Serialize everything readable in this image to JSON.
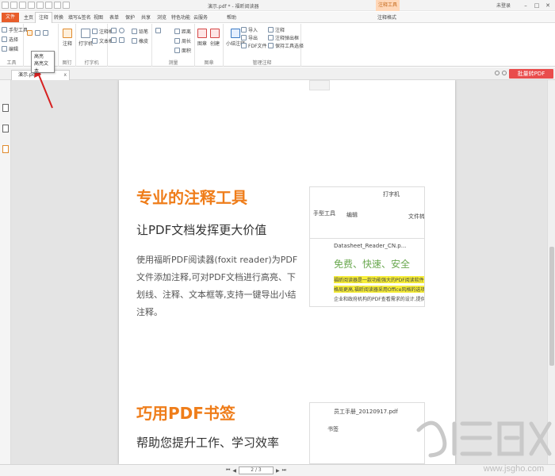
{
  "titlebar": {
    "title": "演示.pdf * - 福昕阅读器",
    "context_tab": "注释工具",
    "login": "未登录"
  },
  "menubar": {
    "file": "文件",
    "tabs": [
      "主页",
      "注释",
      "转换",
      "填写&签名",
      "视图",
      "表单",
      "保护",
      "共享",
      "浏览",
      "特色功能",
      "云服务",
      "帮助",
      "注释格式"
    ],
    "active_tab": "注释",
    "search_placeholder": "查找"
  },
  "ribbon": {
    "tools_group": {
      "items": [
        "手型工具",
        "选择",
        "编辑"
      ],
      "label": "工具"
    },
    "text_markup": {
      "label": "文本标记"
    },
    "pin_group": {
      "items": [
        "注释",
        "文件"
      ],
      "label": "图钉"
    },
    "typewriter": {
      "items": [
        "打字机",
        "注释框",
        "文本框"
      ],
      "label": "打字机"
    },
    "drawing": {
      "items": [
        "铅笔",
        "橡皮"
      ],
      "label": "绘图"
    },
    "measure": {
      "items": [
        "距离",
        "周长",
        "面积"
      ],
      "label": "测量"
    },
    "stamp": {
      "items": [
        "图章",
        "创建"
      ],
      "label": "图章"
    },
    "manage": {
      "items": [
        "小结注释",
        "导入",
        "导出",
        "FDF文件",
        "注释",
        "注释弹出框",
        "保持工具选择"
      ],
      "label": "管理注释"
    }
  },
  "tooltip": {
    "title": "高亮",
    "desc": "高亮文本"
  },
  "doc_tab": {
    "name": "演示.pdf *",
    "close": "x"
  },
  "toolbar_right": {
    "batch_pdf": "批量转PDF"
  },
  "page": {
    "section1": {
      "title": "专业的注释工具",
      "subtitle": "让PDF文档发挥更大价值",
      "paragraph": "使用福昕PDF阅读器(foxit reader)为PDF文件添加注释,可对PDF文档进行高亮、下划线、注释、文本框等,支持一键导出小结注释。"
    },
    "section2": {
      "title": "巧用PDF书签",
      "subtitle": "帮助您提升工作、学习效率"
    }
  },
  "screenshot1": {
    "tools": [
      "手型工具",
      "编辑",
      "打字机",
      "文件转换"
    ],
    "tab": "Datasheet_Reader_CN.p...",
    "green_title": "免费、快速、安全",
    "lines": [
      "福昕阅读器是一款功能强大的PDF阅读软件,具有",
      "格局更高,福昕阅读器采用Office风格的选项卡式",
      "企业和政府机构的PDF查看需求的设计,提供批量"
    ]
  },
  "screenshot2": {
    "tab": "员工手册_20120917.pdf",
    "panel_title": "书签"
  },
  "status": {
    "page_indicator": "2 / 3"
  },
  "watermark": {
    "text": "系统之家",
    "url": "www.jsgho.com"
  },
  "colors": {
    "accent_orange": "#ef7d1a",
    "file_button": "#e85d2a",
    "batch_button": "#e94c4c",
    "highlight": "#f7ee39",
    "arrow": "#d62020"
  }
}
